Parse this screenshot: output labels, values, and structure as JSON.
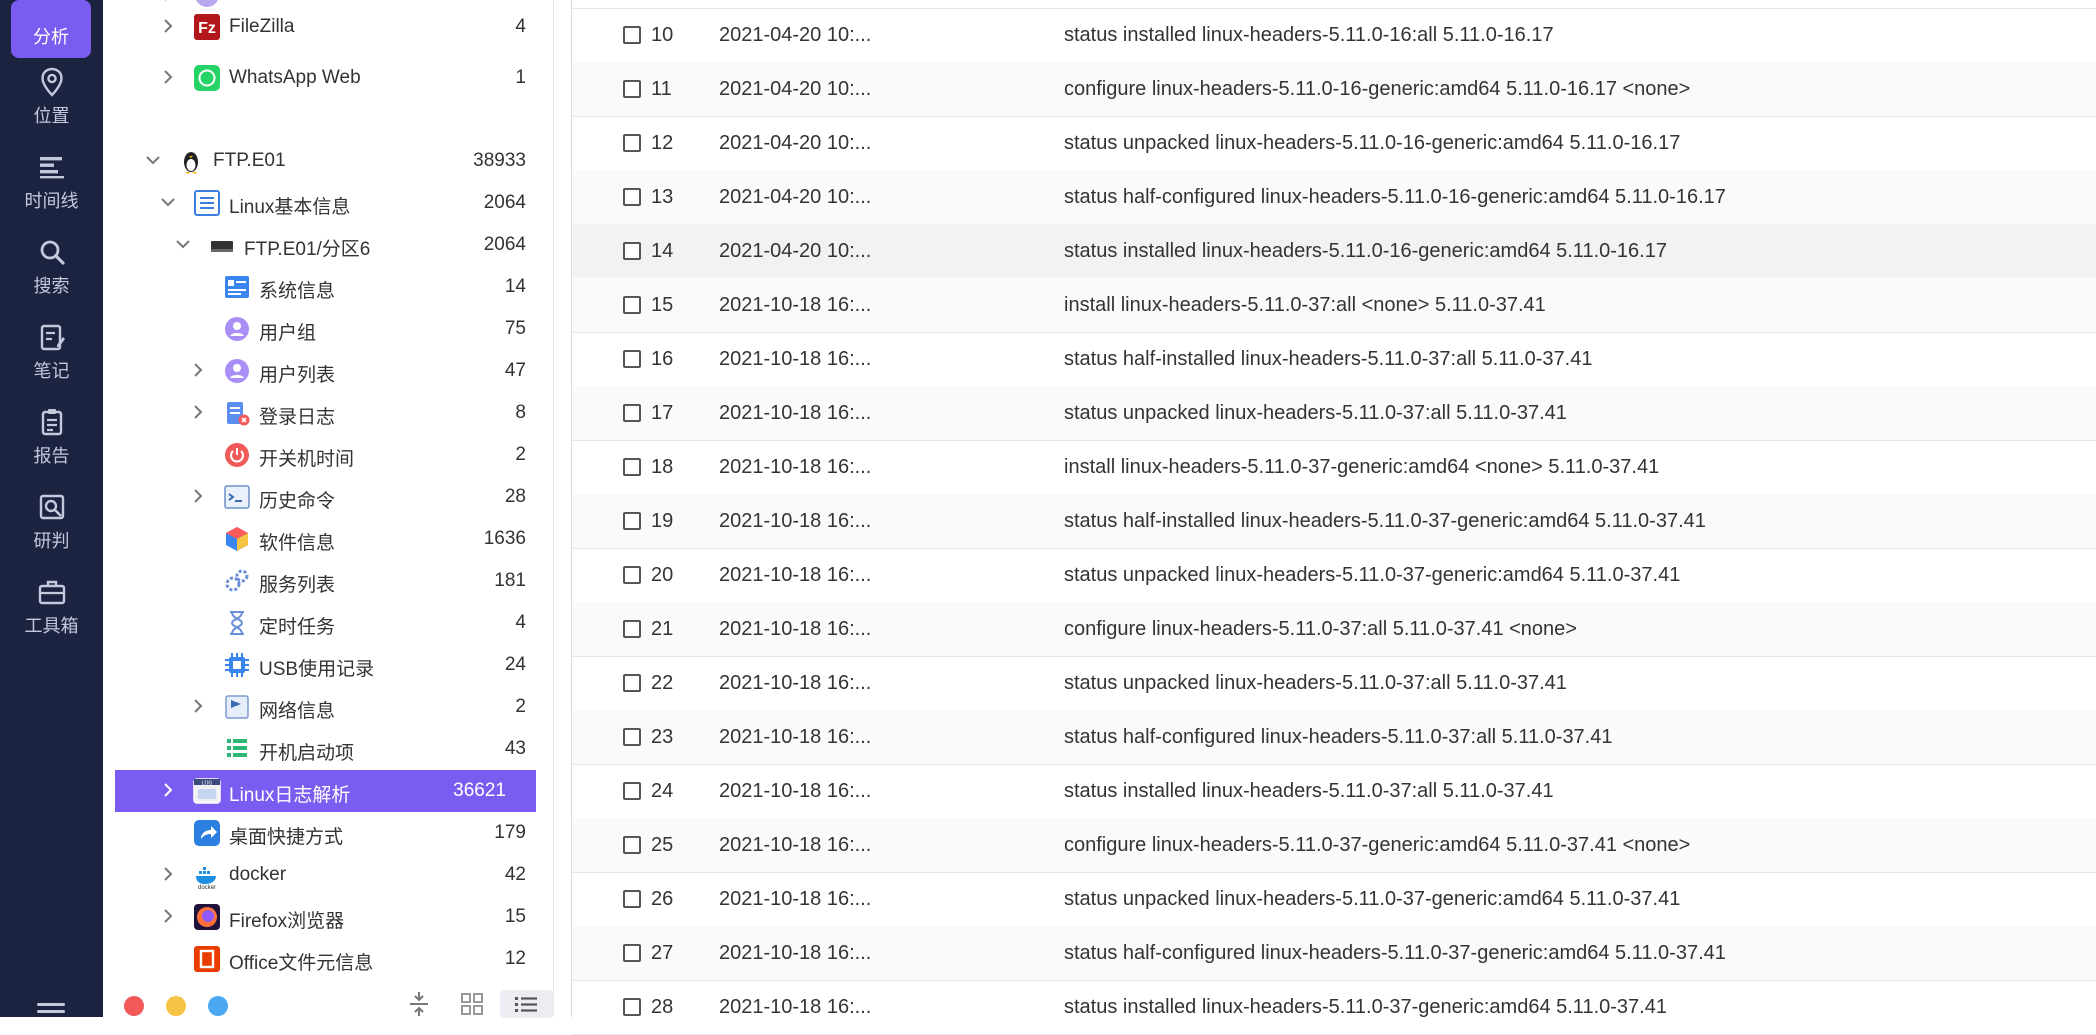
{
  "nav": {
    "items": [
      {
        "label": "分析",
        "icon": "monitor-icon",
        "active": true
      },
      {
        "label": "位置",
        "icon": "location-pin-icon"
      },
      {
        "label": "时间线",
        "icon": "timeline-icon"
      },
      {
        "label": "搜索",
        "icon": "search-icon"
      },
      {
        "label": "笔记",
        "icon": "notes-icon"
      },
      {
        "label": "报告",
        "icon": "report-icon"
      },
      {
        "label": "研判",
        "icon": "analysis-icon"
      },
      {
        "label": "工具箱",
        "icon": "toolbox-icon"
      }
    ],
    "accent": "#7b5cf0",
    "background": "#1c2340"
  },
  "tree": {
    "rows": [
      {
        "label": "FileZilla",
        "count": "4",
        "icon": "filezilla-icon",
        "has_chevron": true
      },
      {
        "label": "WhatsApp Web",
        "count": "1",
        "icon": "whatsapp-icon",
        "has_chevron": true
      },
      {
        "label": "FTP.E01",
        "count": "38933",
        "icon": "linux-tux-icon",
        "has_chevron": true,
        "expanded": true
      },
      {
        "label": "Linux基本信息",
        "count": "2064",
        "icon": "list-icon",
        "has_chevron": true,
        "expanded": true
      },
      {
        "label": "FTP.E01/分区6",
        "count": "2064",
        "icon": "disk-icon",
        "has_chevron": true,
        "expanded": true
      },
      {
        "label": "系统信息",
        "count": "14",
        "icon": "system-info-icon"
      },
      {
        "label": "用户组",
        "count": "75",
        "icon": "user-group-icon"
      },
      {
        "label": "用户列表",
        "count": "47",
        "icon": "user-list-icon",
        "has_chevron": true
      },
      {
        "label": "登录日志",
        "count": "8",
        "icon": "login-log-icon",
        "has_chevron": true
      },
      {
        "label": "开关机时间",
        "count": "2",
        "icon": "power-icon"
      },
      {
        "label": "历史命令",
        "count": "28",
        "icon": "terminal-icon",
        "has_chevron": true
      },
      {
        "label": "软件信息",
        "count": "1636",
        "icon": "software-cube-icon"
      },
      {
        "label": "服务列表",
        "count": "181",
        "icon": "service-gears-icon"
      },
      {
        "label": "定时任务",
        "count": "4",
        "icon": "hourglass-icon"
      },
      {
        "label": "USB使用记录",
        "count": "24",
        "icon": "usb-chip-icon"
      },
      {
        "label": "网络信息",
        "count": "2",
        "icon": "network-icon",
        "has_chevron": true
      },
      {
        "label": "开机启动项",
        "count": "43",
        "icon": "startup-icon"
      },
      {
        "label": "Linux日志解析",
        "count": "36621",
        "icon": "log-icon",
        "has_chevron": true,
        "selected": true
      },
      {
        "label": "桌面快捷方式",
        "count": "179",
        "icon": "shortcut-icon"
      },
      {
        "label": "docker",
        "count": "42",
        "icon": "docker-icon",
        "has_chevron": true
      },
      {
        "label": "Firefox浏览器",
        "count": "15",
        "icon": "firefox-icon",
        "has_chevron": true
      },
      {
        "label": "Office文件元信息",
        "count": "12",
        "icon": "office-icon"
      }
    ]
  },
  "footer": {
    "dots": [
      "#f25a5a",
      "#f5c445",
      "#4aa8f2"
    ],
    "buttons": [
      "collapse-icon",
      "grid-view-icon",
      "list-view-icon"
    ]
  },
  "table": {
    "rows": [
      {
        "num": "10",
        "time": "2021-04-20 10:...",
        "msg": "status installed linux-headers-5.11.0-16:all 5.11.0-16.17"
      },
      {
        "num": "11",
        "time": "2021-04-20 10:...",
        "msg": "configure linux-headers-5.11.0-16-generic:amd64 5.11.0-16.17 <none>"
      },
      {
        "num": "12",
        "time": "2021-04-20 10:...",
        "msg": "status unpacked linux-headers-5.11.0-16-generic:amd64 5.11.0-16.17"
      },
      {
        "num": "13",
        "time": "2021-04-20 10:...",
        "msg": "status half-configured linux-headers-5.11.0-16-generic:amd64 5.11.0-16.17"
      },
      {
        "num": "14",
        "time": "2021-04-20 10:...",
        "msg": "status installed linux-headers-5.11.0-16-generic:amd64 5.11.0-16.17"
      },
      {
        "num": "15",
        "time": "2021-10-18 16:...",
        "msg": "install linux-headers-5.11.0-37:all <none> 5.11.0-37.41"
      },
      {
        "num": "16",
        "time": "2021-10-18 16:...",
        "msg": "status half-installed linux-headers-5.11.0-37:all 5.11.0-37.41"
      },
      {
        "num": "17",
        "time": "2021-10-18 16:...",
        "msg": "status unpacked linux-headers-5.11.0-37:all 5.11.0-37.41"
      },
      {
        "num": "18",
        "time": "2021-10-18 16:...",
        "msg": "install linux-headers-5.11.0-37-generic:amd64 <none> 5.11.0-37.41"
      },
      {
        "num": "19",
        "time": "2021-10-18 16:...",
        "msg": "status half-installed linux-headers-5.11.0-37-generic:amd64 5.11.0-37.41"
      },
      {
        "num": "20",
        "time": "2021-10-18 16:...",
        "msg": "status unpacked linux-headers-5.11.0-37-generic:amd64 5.11.0-37.41"
      },
      {
        "num": "21",
        "time": "2021-10-18 16:...",
        "msg": "configure linux-headers-5.11.0-37:all 5.11.0-37.41 <none>"
      },
      {
        "num": "22",
        "time": "2021-10-18 16:...",
        "msg": "status unpacked linux-headers-5.11.0-37:all 5.11.0-37.41"
      },
      {
        "num": "23",
        "time": "2021-10-18 16:...",
        "msg": "status half-configured linux-headers-5.11.0-37:all 5.11.0-37.41"
      },
      {
        "num": "24",
        "time": "2021-10-18 16:...",
        "msg": "status installed linux-headers-5.11.0-37:all 5.11.0-37.41"
      },
      {
        "num": "25",
        "time": "2021-10-18 16:...",
        "msg": "configure linux-headers-5.11.0-37-generic:amd64 5.11.0-37.41 <none>"
      },
      {
        "num": "26",
        "time": "2021-10-18 16:...",
        "msg": "status unpacked linux-headers-5.11.0-37-generic:amd64 5.11.0-37.41"
      },
      {
        "num": "27",
        "time": "2021-10-18 16:...",
        "msg": "status half-configured linux-headers-5.11.0-37-generic:amd64 5.11.0-37.41"
      },
      {
        "num": "28",
        "time": "2021-10-18 16:...",
        "msg": "status installed linux-headers-5.11.0-37-generic:amd64 5.11.0-37.41"
      }
    ],
    "highlighted_row": "14"
  }
}
